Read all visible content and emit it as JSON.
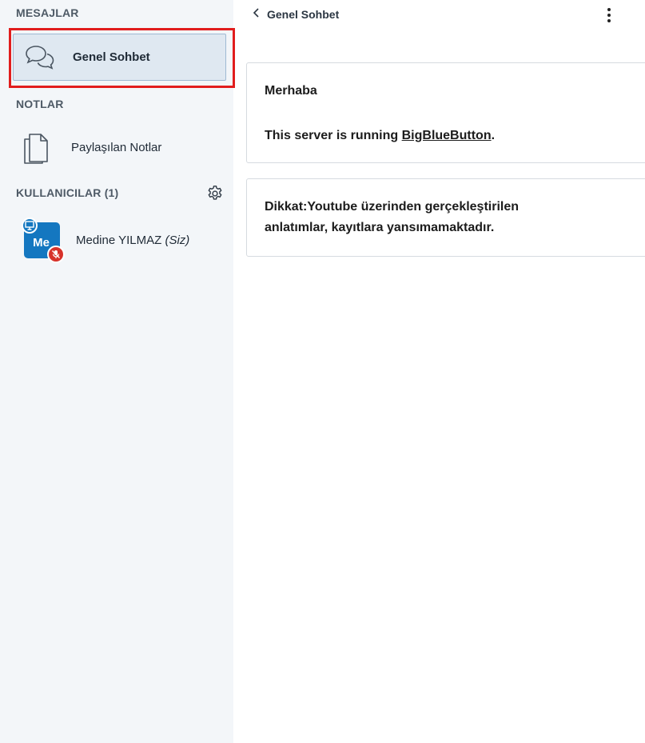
{
  "sidebar": {
    "messages_title": "MESAJLAR",
    "chat_item_label": "Genel Sohbet",
    "notes_title": "NOTLAR",
    "notes_item_label": "Paylaşılan Notlar",
    "users_title": "KULLANICILAR (1)",
    "user": {
      "initials": "Me",
      "name": "Medine YILMAZ",
      "you_label": "(Siz)"
    }
  },
  "chat": {
    "header_title": "Genel Sohbet",
    "welcome_title": "Merhaba",
    "welcome_prefix": "This server is running ",
    "welcome_link": "BigBlueButton",
    "welcome_suffix": ".",
    "note_label": "Dikkat:",
    "note_line1_rest": "Youtube üzerinden gerçekleştirilen",
    "note_line2_prefix": "anlatımlar, kayıtlara ",
    "note_line2_bold": "yansımamaktadır."
  },
  "colors": {
    "sidebar_bg": "#f3f6f9",
    "highlight_border": "#e11d1d",
    "avatar_bg": "#1477c0",
    "muted_badge": "#d7322b"
  }
}
